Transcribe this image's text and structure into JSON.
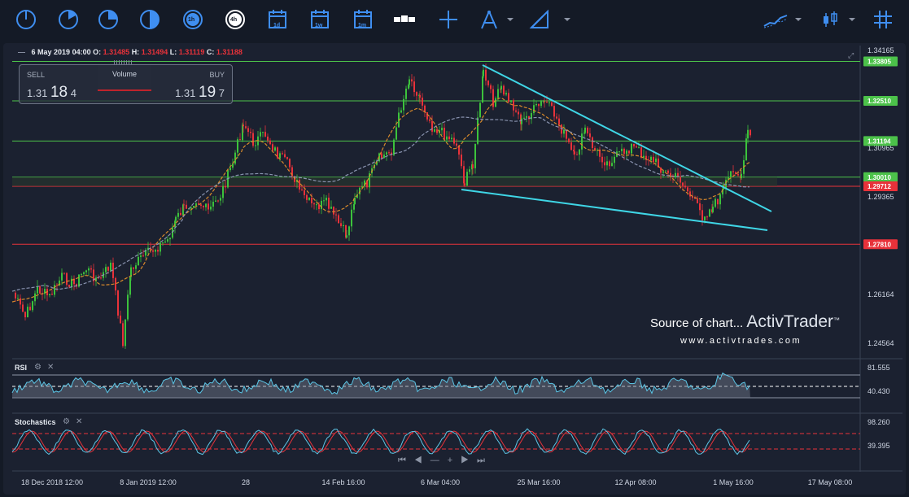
{
  "ohlc": {
    "date": "6 May 2019 04:00",
    "o_label": "O:",
    "o": "1.31485",
    "h_label": "H:",
    "h": "1.31494",
    "l_label": "L:",
    "l": "1.31119",
    "c_label": "C:",
    "c": "1.31188"
  },
  "trade": {
    "sell_label": "SELL",
    "buy_label": "BUY",
    "sell_small": "1.31",
    "sell_big": "18",
    "sell_tail": "4",
    "buy_small": "1.31",
    "buy_big": "19",
    "buy_tail": "7",
    "volume_label": "Volume"
  },
  "toolbar": {
    "timeframes": [
      "1h",
      "4h"
    ],
    "calendar_labels": [
      "1d",
      "1w",
      "1m"
    ]
  },
  "chart_data": {
    "type": "candlestick",
    "y_ticks": [
      1.34165,
      1.30965,
      1.29365,
      1.26164,
      1.24564
    ],
    "price_tags": [
      {
        "value": "1.33805",
        "color": "#4cc24a"
      },
      {
        "value": "1.32510",
        "color": "#4cc24a"
      },
      {
        "value": "1.31194",
        "color": "#4cc24a"
      },
      {
        "value": "1.30010",
        "color": "#4cc24a"
      },
      {
        "value": "1.29712",
        "color": "#e8323a"
      },
      {
        "value": "1.27810",
        "color": "#e8323a"
      }
    ],
    "x_ticks": [
      "18 Dec 2018 12:00",
      "8 Jan 2019 12:00",
      "28",
      "14 Feb 16:00",
      "6 Mar 04:00",
      "25 Mar 16:00",
      "12 Apr 08:00",
      "1 May 16:00",
      "17 May 08:00"
    ],
    "colors": {
      "up": "#3cc23c",
      "down": "#e8323a",
      "trendline": "#3fd6e6",
      "ma_fast": "#d98a2b",
      "ma_slow": "#8a94b0"
    }
  },
  "rsi": {
    "label": "RSI",
    "levels": [
      "81.555",
      "40.430"
    ]
  },
  "stochastics": {
    "label": "Stochastics",
    "levels": [
      "98.260",
      "39.395"
    ]
  },
  "watermark": {
    "line1": "Source of chart...",
    "brand": "ActivTrader",
    "tm": "™",
    "url": "www.activtrades.com"
  }
}
